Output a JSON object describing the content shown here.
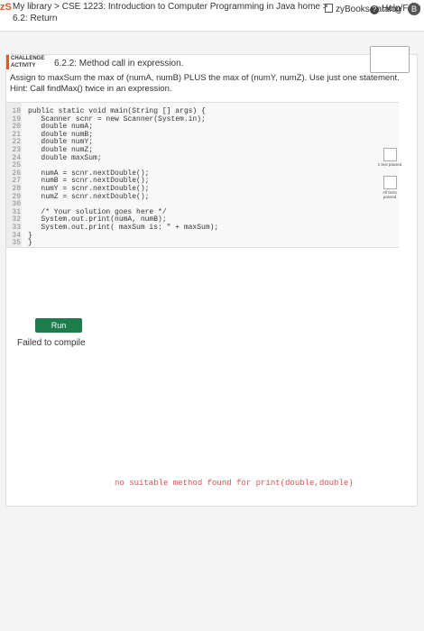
{
  "header": {
    "logo": "zS",
    "breadcrumb_line1": "My library > CSE 1223: Introduction to Computer Programming in Java home >",
    "breadcrumb_line2": "6.2: Return",
    "catalog_label": "zyBooks catalog",
    "help_label": "Help/FAQ",
    "avatar_letter": "B"
  },
  "activity": {
    "badge_line1": "CHALLENGE",
    "badge_line2": "ACTIVITY",
    "title": "6.2.2: Method call in expression.",
    "instructions": "Assign to maxSum the max of (numA, numB) PLUS the max of (numY, numZ). Use just one statement. Hint: Call findMax() twice in an expression."
  },
  "code": {
    "lines": [
      {
        "num": "18",
        "text": "public static void main(String [] args) {"
      },
      {
        "num": "19",
        "text": "   Scanner scnr = new Scanner(System.in);"
      },
      {
        "num": "20",
        "text": "   double numA;"
      },
      {
        "num": "21",
        "text": "   double numB;"
      },
      {
        "num": "22",
        "text": "   double numY;"
      },
      {
        "num": "23",
        "text": "   double numZ;"
      },
      {
        "num": "24",
        "text": "   double maxSum;"
      },
      {
        "num": "25",
        "text": ""
      },
      {
        "num": "26",
        "text": "   numA = scnr.nextDouble();"
      },
      {
        "num": "27",
        "text": "   numB = scnr.nextDouble();"
      },
      {
        "num": "28",
        "text": "   numY = scnr.nextDouble();"
      },
      {
        "num": "29",
        "text": "   numZ = scnr.nextDouble();"
      },
      {
        "num": "30",
        "text": ""
      },
      {
        "num": "31",
        "text": "   /* Your solution goes here */"
      },
      {
        "num": "32",
        "text": "   System.out.print(numA, numB);"
      },
      {
        "num": "33",
        "text": "   System.out.print( maxSum is: \" + maxSum);"
      },
      {
        "num": "34",
        "text": "}"
      },
      {
        "num": "35",
        "text": "}"
      }
    ]
  },
  "run_label": "Run",
  "status": "Failed to compile",
  "error_text": "no suitable method found for print(double,double)",
  "side_labels": {
    "test1": "1 test passed",
    "test2": "All tests passed"
  }
}
